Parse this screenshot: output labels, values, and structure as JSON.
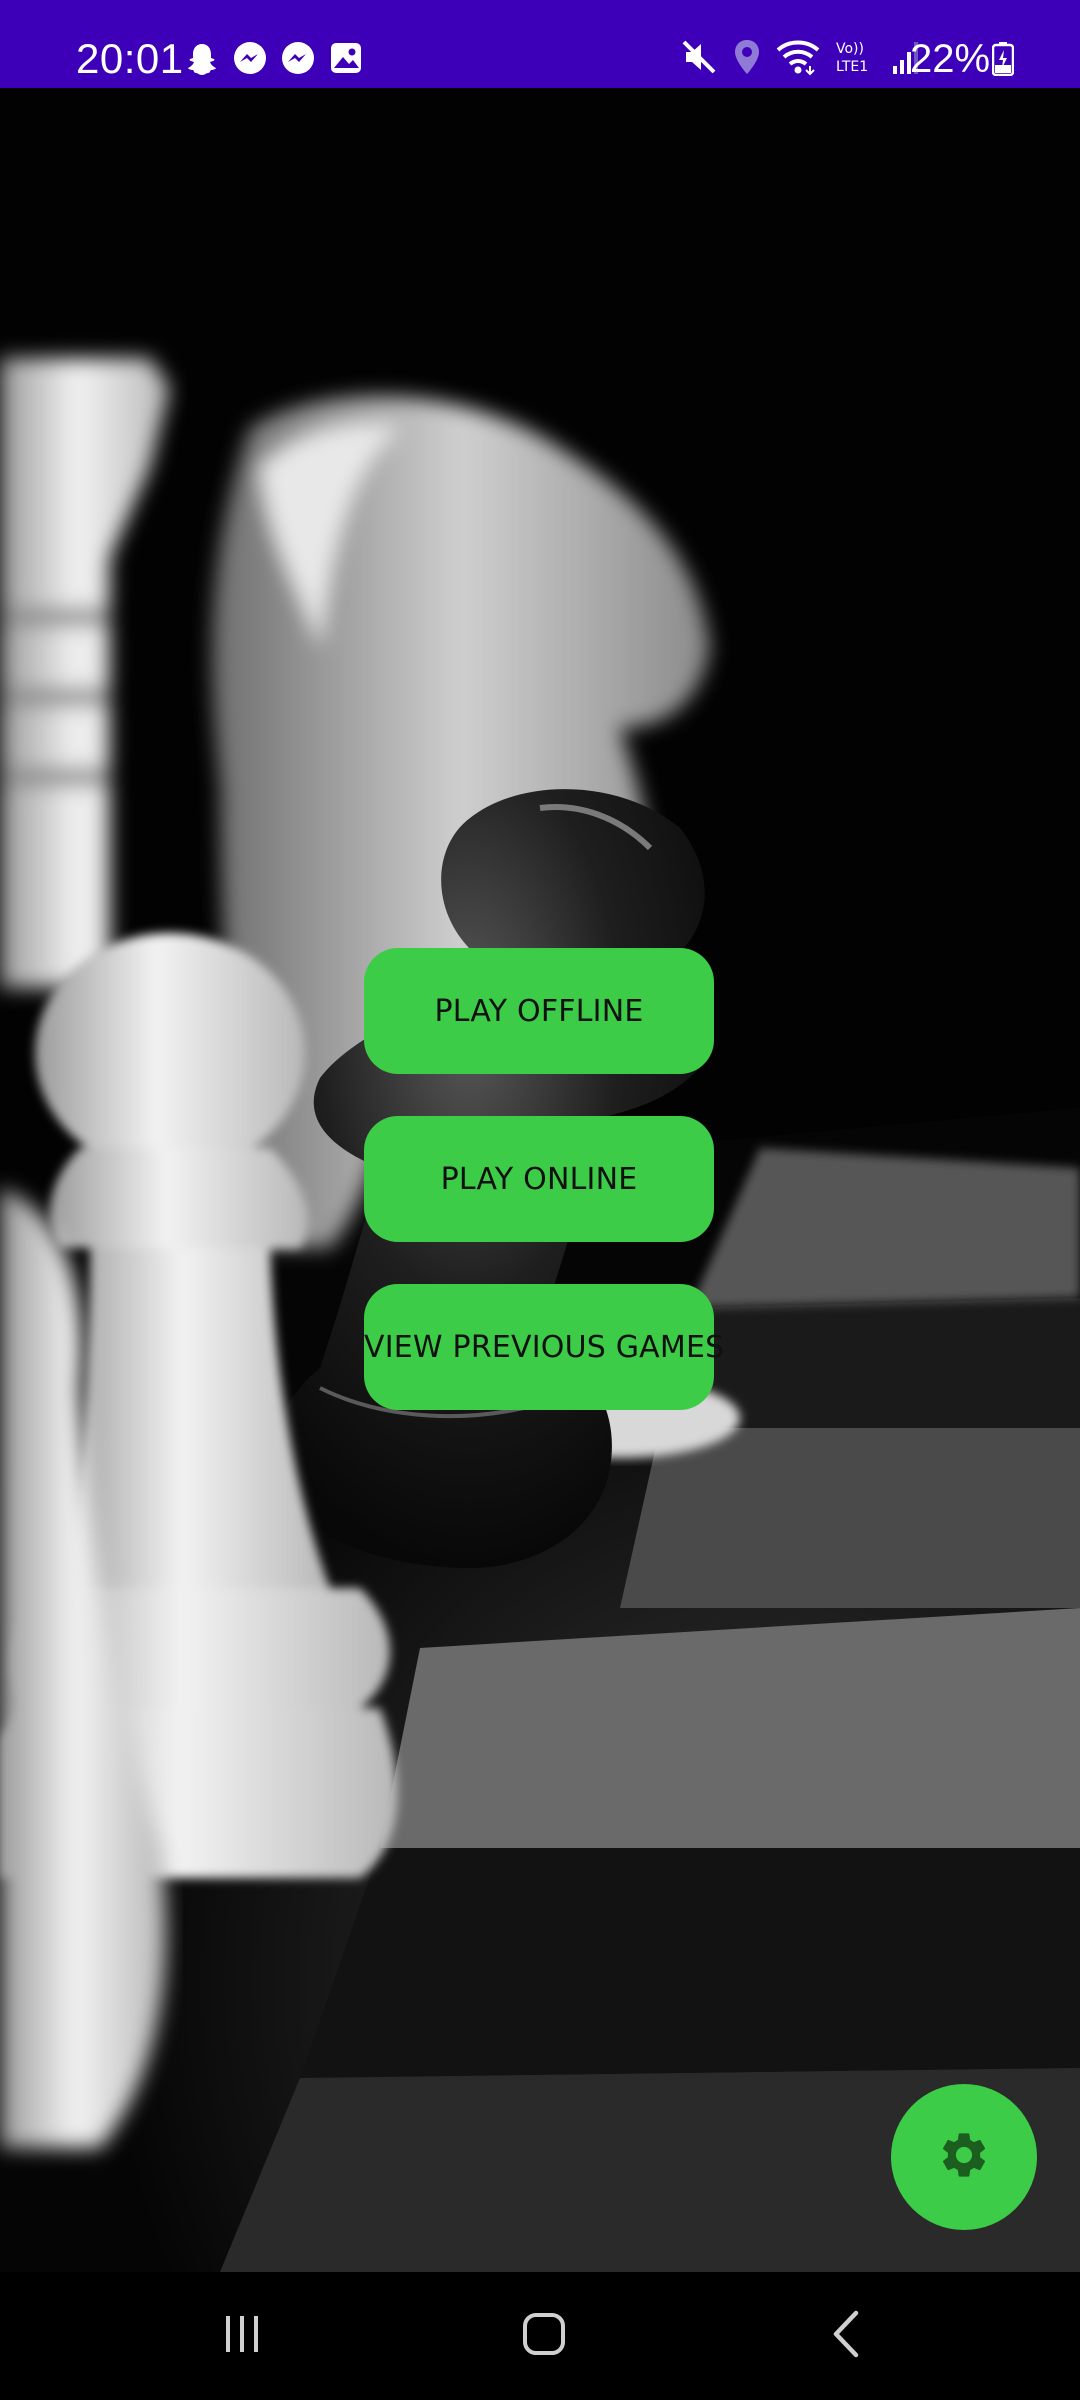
{
  "status_bar": {
    "time": "20:01",
    "battery": "22%",
    "background_color": "#3d00b8",
    "left_icons": [
      "snapchat-icon",
      "messenger-icon",
      "messenger-icon",
      "gallery-icon"
    ],
    "right_icons": [
      "mute-icon",
      "location-icon",
      "wifi-icon",
      "volte-icon",
      "signal-icon",
      "battery-charging-icon"
    ],
    "volte_label": "Vo))",
    "lte_label": "LTE1"
  },
  "main_menu": {
    "play_offline_label": "PLAY OFFLINE",
    "play_online_label": "PLAY ONLINE",
    "view_previous_games_label": "VIEW PREVIOUS GAMES",
    "button_color": "#3dcc47",
    "button_text_color": "#111111"
  },
  "fab": {
    "icon": "gear-icon",
    "background_color": "#3dcc47",
    "icon_color": "#1b5e20"
  },
  "nav_bar": {
    "icons": [
      "recents-icon",
      "home-icon",
      "back-icon"
    ]
  }
}
